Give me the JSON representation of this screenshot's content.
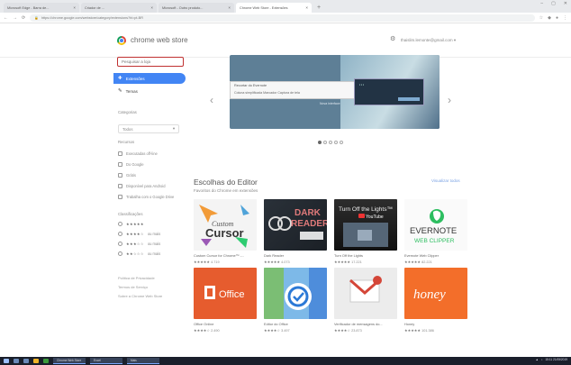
{
  "browser": {
    "tabs": [
      {
        "title": "Microsoft Edge - Barra de..."
      },
      {
        "title": "Criador de ..."
      },
      {
        "title": "Microsoft - Outro produto..."
      },
      {
        "title": "Chrome Web Store - Extensões"
      }
    ],
    "new_tab": "+",
    "window_controls": [
      "–",
      "▢",
      "✕"
    ],
    "url": "https://chrome.google.com/webstore/category/extensions?hl=pt-BR"
  },
  "header": {
    "store_title": "chrome web store",
    "user": "thaislim.lemonte@gmail.com ▾"
  },
  "sidebar": {
    "search_placeholder": "Pesquisar a loja",
    "nav": [
      {
        "label": "Extensões",
        "icon": "puzzle-icon"
      },
      {
        "label": "Temas",
        "icon": "brush-icon"
      }
    ],
    "categories_label": "Categorias",
    "categories_value": "Todos",
    "features_label": "Recursos",
    "features": [
      "Executadas off-line",
      "Do Google",
      "Grátis",
      "Disponível para Android",
      "Trabalha com o Google Drive"
    ],
    "ratings_label": "Classificações",
    "ratings": [
      {
        "stars": "★★★★★",
        "suffix": ""
      },
      {
        "stars": "★★★★☆",
        "suffix": "ou mais"
      },
      {
        "stars": "★★★☆☆",
        "suffix": "ou mais"
      },
      {
        "stars": "★★☆☆☆",
        "suffix": "ou mais"
      }
    ],
    "links": [
      "Política de Privacidade",
      "Termos de Serviço",
      "Sobre a Chrome Web Store"
    ]
  },
  "carousel": {
    "title": "Recortar do Evernote",
    "tabs_text": "Coluna simplificada   Marcador   Captura de tela",
    "subtitle": "Nova interface",
    "dots": 5,
    "active_dot": 0,
    "accent": "#5e7f96"
  },
  "section": {
    "title": "Escolhas do Editor",
    "subtitle": "Favoritos do Chrome em extensões",
    "more": "Visualizar todos"
  },
  "cards": [
    {
      "name": "Custom Cursor for Chrome™ -...",
      "stars": "★★★★★",
      "count": "4.719",
      "thumb": "cursor"
    },
    {
      "name": "Dark Reader",
      "stars": "★★★★★",
      "count": "4.073",
      "thumb": "dark"
    },
    {
      "name": "Turn Off the Lights",
      "stars": "★★★★★",
      "count": "17.221",
      "thumb": "lights"
    },
    {
      "name": "Evernote Web Clipper",
      "stars": "★★★★★",
      "count": "82.221",
      "thumb": "evernote"
    },
    {
      "name": "Office Online",
      "stars": "★★★★☆",
      "count": "2.490",
      "thumb": "office"
    },
    {
      "name": "Editor do Office",
      "stars": "★★★★☆",
      "count": "3.497",
      "thumb": "editor"
    },
    {
      "name": "Verificador de mensagens do...",
      "stars": "★★★★☆",
      "count": "23.873",
      "thumb": "gmail"
    },
    {
      "name": "Honey",
      "stars": "★★★★★",
      "count": "101.386",
      "thumb": "honey"
    }
  ],
  "thumbs": {
    "cursor": {
      "t1": "Custom",
      "t2": "Cursor"
    },
    "dark": {
      "t1": "DARK",
      "t2": "READER"
    },
    "lights": {
      "t1": "Turn Off the Lights™",
      "t2": "YouTube"
    },
    "evernote": {
      "t1": "EVERNOTE",
      "t2": "WEB CLIPPER"
    },
    "office": {
      "t1": "Office"
    },
    "honey": {
      "t1": "honey"
    }
  },
  "taskbar": {
    "windows": [
      "Chrome Web Store",
      "Excel",
      "Mais"
    ],
    "time": "15:11",
    "date": "21/05/2019"
  }
}
